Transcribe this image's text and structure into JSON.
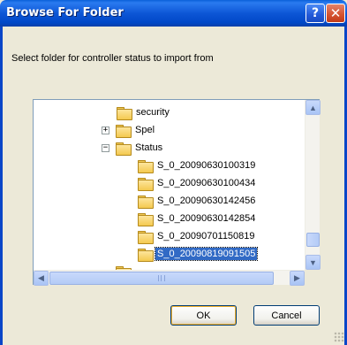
{
  "window": {
    "title": "Browse For Folder",
    "help_label": "?",
    "close_label": "✕"
  },
  "instruction": "Select folder for controller status to import from",
  "tree": {
    "items": [
      {
        "label": "security",
        "expander": "",
        "selected": false
      },
      {
        "label": "Spel",
        "expander": "+",
        "selected": false
      },
      {
        "label": "Status",
        "expander": "−",
        "selected": false
      },
      {
        "label": "S_0_20090630100319",
        "expander": "",
        "selected": false
      },
      {
        "label": "S_0_20090630100434",
        "expander": "",
        "selected": false
      },
      {
        "label": "S_0_20090630142456",
        "expander": "",
        "selected": false
      },
      {
        "label": "S_0_20090630142854",
        "expander": "",
        "selected": false
      },
      {
        "label": "S_0_20090701150819",
        "expander": "",
        "selected": false
      },
      {
        "label": "S_0_20090819091505",
        "expander": "",
        "selected": true
      }
    ]
  },
  "scroll": {
    "up": "▲",
    "down": "▼",
    "left": "◀",
    "right": "▶"
  },
  "buttons": {
    "ok": "OK",
    "cancel": "Cancel"
  },
  "colors": {
    "titlebar": "#0a5fd8",
    "selection": "#316ac5",
    "face": "#ece9d8"
  }
}
